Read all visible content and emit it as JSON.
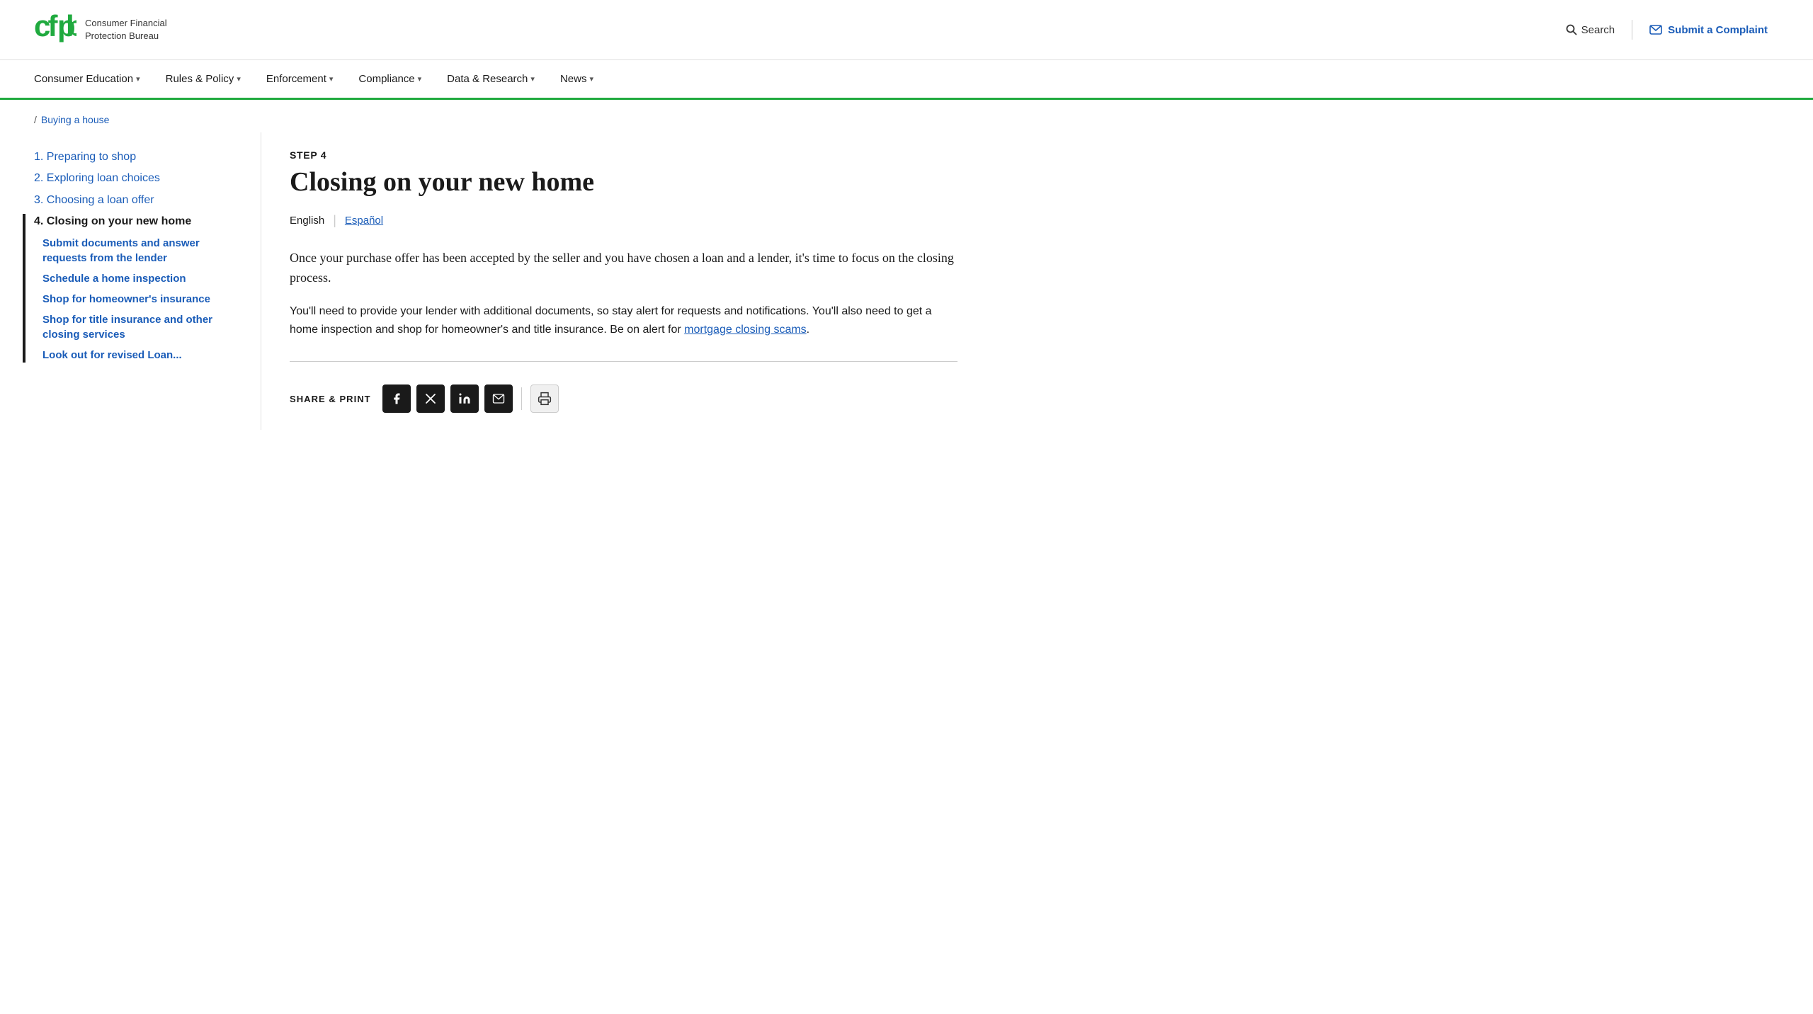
{
  "site": {
    "name": "Consumer Financial Protection Bureau",
    "logo_alt": "CFPB"
  },
  "header": {
    "search_label": "Search",
    "complaint_label": "Submit a Complaint"
  },
  "nav": {
    "items": [
      {
        "label": "Consumer Education",
        "has_dropdown": true
      },
      {
        "label": "Rules & Policy",
        "has_dropdown": true
      },
      {
        "label": "Enforcement",
        "has_dropdown": true
      },
      {
        "label": "Compliance",
        "has_dropdown": true
      },
      {
        "label": "Data & Research",
        "has_dropdown": true
      },
      {
        "label": "News",
        "has_dropdown": true
      }
    ]
  },
  "breadcrumb": {
    "separator": "/",
    "parent_label": "Buying a house",
    "parent_href": "#"
  },
  "sidebar": {
    "items": [
      {
        "id": "step1",
        "label": "1. Preparing to shop",
        "active": false
      },
      {
        "id": "step2",
        "label": "2. Exploring loan choices",
        "active": false
      },
      {
        "id": "step3",
        "label": "3. Choosing a loan offer",
        "active": false
      },
      {
        "id": "step4",
        "label": "4. Closing on your new home",
        "active": true
      }
    ],
    "sub_items": [
      {
        "id": "sub1",
        "label": "Submit documents and answer requests from the lender"
      },
      {
        "id": "sub2",
        "label": "Schedule a home inspection"
      },
      {
        "id": "sub3",
        "label": "Shop for homeowner's insurance"
      },
      {
        "id": "sub4",
        "label": "Shop for title insurance and other closing services"
      },
      {
        "id": "sub5",
        "label": "Look out for revised Loan..."
      }
    ]
  },
  "content": {
    "step_label": "STEP 4",
    "page_title": "Closing on your new home",
    "lang_current": "English",
    "lang_alt": "Español",
    "intro_paragraph": "Once your purchase offer has been accepted by the seller and you have chosen a loan and a lender, it's time to focus on the closing process.",
    "body_paragraph_before_link": "You'll need to provide your lender with additional documents, so stay alert for requests and notifications. You'll also need to get a home inspection and shop for homeowner's and title insurance. Be on alert for ",
    "inline_link_text": "mortgage closing scams",
    "inline_link_href": "#",
    "body_paragraph_after_link": "."
  },
  "share": {
    "label": "SHARE & PRINT",
    "icons": [
      {
        "id": "facebook",
        "symbol": "f",
        "aria": "Share on Facebook"
      },
      {
        "id": "twitter-x",
        "symbol": "𝕏",
        "aria": "Share on X"
      },
      {
        "id": "linkedin",
        "symbol": "in",
        "aria": "Share on LinkedIn"
      },
      {
        "id": "email",
        "symbol": "✉",
        "aria": "Share via Email"
      }
    ],
    "print_aria": "Print"
  }
}
